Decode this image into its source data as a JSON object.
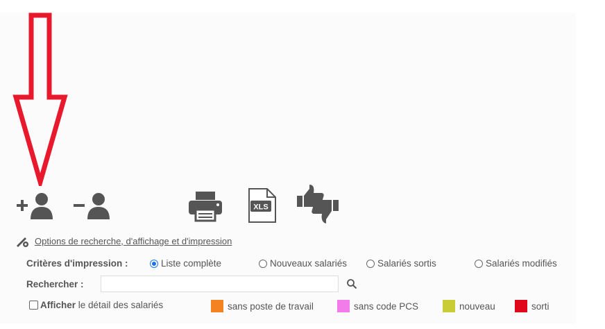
{
  "colors": {
    "arrow": "#e8192c",
    "icon": "#555555",
    "radio_selected": "#1a73e8"
  },
  "toolbar": {
    "icons": [
      "add-user-icon",
      "remove-user-icon",
      "print-icon",
      "xls-file-icon",
      "thumbs-up-down-icon"
    ],
    "xls_label": "XLS"
  },
  "options_link": "Options de recherche, d'affichage et d'impression",
  "criteria": {
    "label": "Critères d'impression :",
    "selected": "Liste complète",
    "options": [
      "Liste complète",
      "Nouveaux salariés",
      "Salariés sortis",
      "Salariés modifiés"
    ]
  },
  "search": {
    "label": "Rechercher :",
    "value": "",
    "placeholder": ""
  },
  "detail": {
    "checked": false,
    "label_bold": "Afficher",
    "label_rest": "le détail des salariés"
  },
  "legend": [
    {
      "label": "sans poste de travail",
      "color": "#f58220"
    },
    {
      "label": "sans code PCS",
      "color": "#f27ce9"
    },
    {
      "label": "nouveau",
      "color": "#c9cc34"
    },
    {
      "label": "sorti",
      "color": "#e0091c"
    }
  ]
}
